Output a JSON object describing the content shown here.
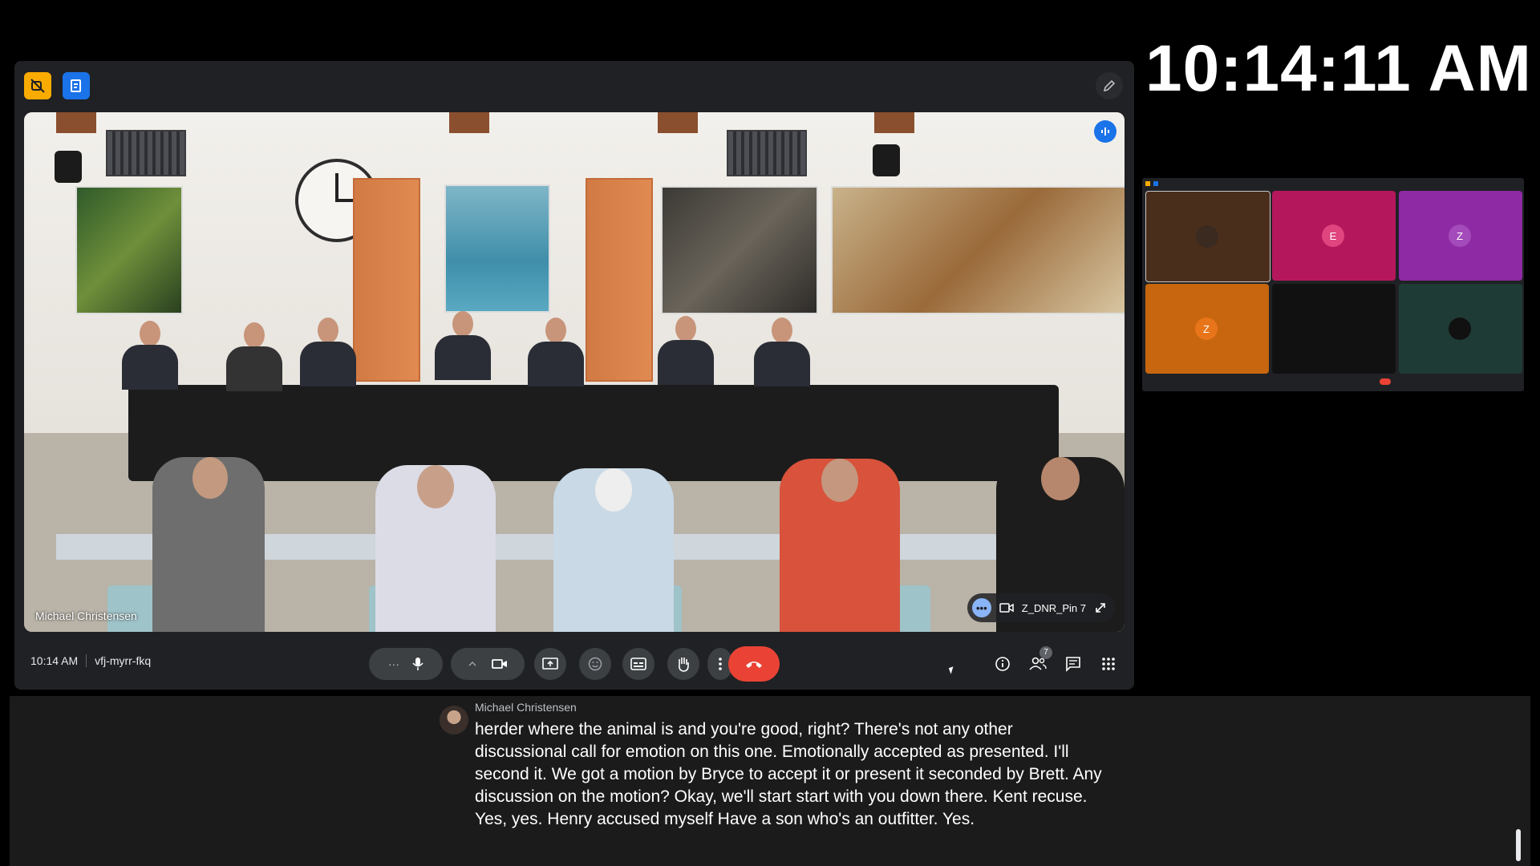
{
  "overlay_clock": "10:14:11 AM",
  "meeting": {
    "time": "10:14 AM",
    "code": "vfj-myrr-fkq"
  },
  "video": {
    "speaker_name": "Michael Christensen",
    "pinned_tile_name": "Z_DNR_Pin 7"
  },
  "participants": {
    "count": "7"
  },
  "mini_grid": {
    "tiles": [
      {
        "avatar": "",
        "color": "#4a2e1c"
      },
      {
        "avatar": "E",
        "color": "#b5175c"
      },
      {
        "avatar": "Z",
        "color": "#8e2aa3"
      },
      {
        "avatar": "Z",
        "color": "#c7660e"
      },
      {
        "avatar": "",
        "color": "#111111"
      },
      {
        "avatar": "",
        "color": "#1f3b35"
      }
    ]
  },
  "captions": {
    "speaker": "Michael Christensen",
    "text": "herder where the animal is and you're good, right? There's not any other discussional call for emotion on this one. Emotionally accepted as presented. I'll second it. We got a motion by Bryce to accept it or present it seconded by Brett. Any discussion on the motion? Okay, we'll start start with you down there. Kent recuse. Yes, yes. Henry accused myself Have a son who's an outfitter. Yes."
  },
  "colors": {
    "end_call": "#ea4335",
    "accent_blue": "#1a73e8",
    "warning_yellow": "#f9ab00",
    "toolbar_button": "#3c4043"
  },
  "icons": [
    "no-recording-icon",
    "notes-icon",
    "pencil-icon",
    "audio-level-icon",
    "more-options-icon",
    "camera-icon",
    "expand-icon",
    "microphone-icon",
    "chevron-up-icon",
    "video-camera-icon",
    "present-screen-icon",
    "emoji-icon",
    "captions-icon",
    "raise-hand-icon",
    "more-vert-icon",
    "end-call-icon",
    "info-icon",
    "people-icon",
    "chat-icon",
    "apps-icon"
  ]
}
